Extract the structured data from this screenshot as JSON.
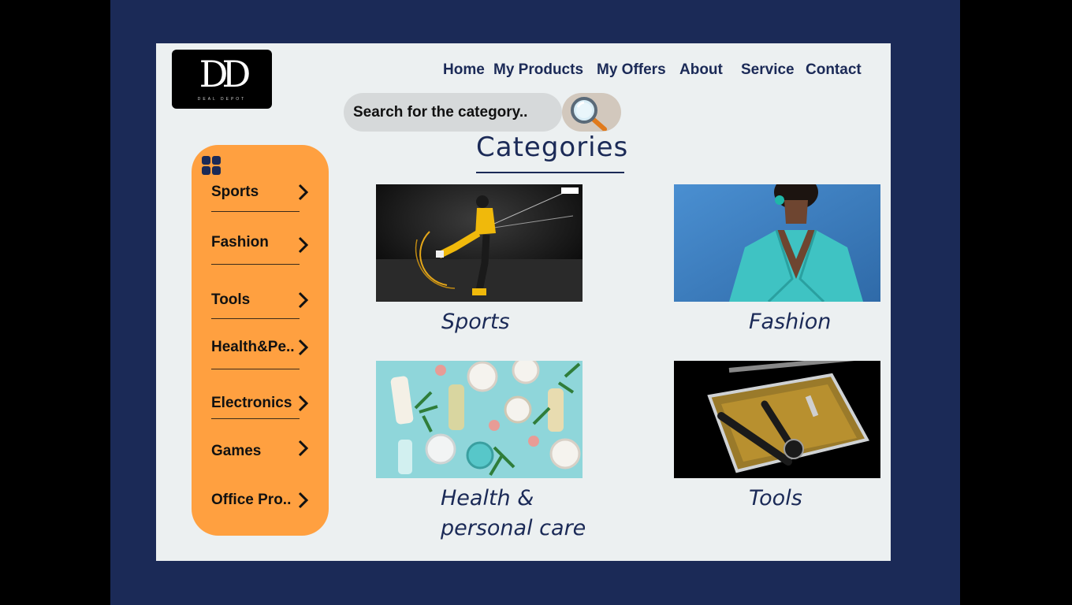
{
  "brand": {
    "logo_text": "DD",
    "logo_subtext": "DEAL DEPOT"
  },
  "nav": [
    {
      "label": "Home"
    },
    {
      "label": "My Products"
    },
    {
      "label": "My Offers"
    },
    {
      "label": "About"
    },
    {
      "label": "Service"
    },
    {
      "label": "Contact"
    }
  ],
  "search": {
    "placeholder": "Search for the category..",
    "icon": "search-icon"
  },
  "categories_title": "Categories",
  "sidebar": {
    "icon": "grid-icon",
    "items": [
      {
        "label": "Sports"
      },
      {
        "label": "Fashion"
      },
      {
        "label": "Tools"
      },
      {
        "label": "Health&Pe.."
      },
      {
        "label": "Electronics"
      },
      {
        "label": "Games"
      },
      {
        "label": "Office Pro.."
      }
    ]
  },
  "cards": [
    {
      "caption": "Sports",
      "image": "soccer-player-image"
    },
    {
      "caption": "Fashion",
      "image": "fashion-model-image"
    },
    {
      "caption_line1": "Health &",
      "caption_line2": "personal care",
      "image": "cosmetics-image"
    },
    {
      "caption": "Tools",
      "image": "tools-image"
    }
  ],
  "colors": {
    "background": "#1b2a57",
    "page": "#ecf0f1",
    "sidebar": "#ffa040",
    "accent_text": "#1b2a57"
  }
}
